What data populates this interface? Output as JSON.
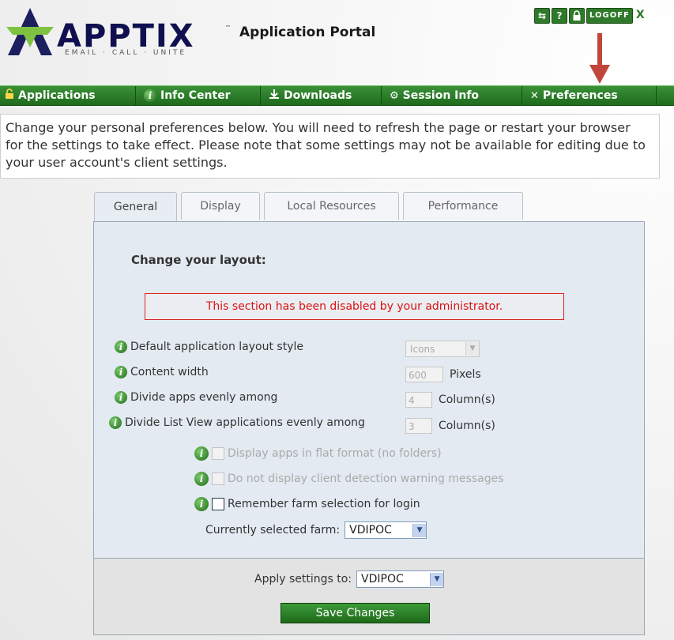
{
  "header": {
    "logo_word": "APPTIX",
    "logo_tm": "™",
    "logo_tagline": "EMAIL · CALL · UNITE",
    "title": "Application Portal",
    "top_icons": [
      "⇆",
      "?",
      "🔒"
    ],
    "logoff_label": "LOGOFF",
    "close_label": "X"
  },
  "nav": {
    "items": [
      {
        "label": "Applications",
        "icon": "lock-icon",
        "glyph": "🔓"
      },
      {
        "label": "Info Center",
        "icon": "info-icon",
        "glyph": "ℹ"
      },
      {
        "label": "Downloads",
        "icon": "download-icon",
        "glyph": "⤓"
      },
      {
        "label": "Session Info",
        "icon": "gear-icon",
        "glyph": "⚙"
      },
      {
        "label": "Preferences",
        "icon": "tools-icon",
        "glyph": "✕"
      }
    ]
  },
  "intro": "Change your personal preferences below. You will need to refresh the page or restart your browser for the settings to take effect. Please note that some settings may not be available for editing due to your user account's client settings.",
  "tabs": [
    "General",
    "Display",
    "Local Resources",
    "Performance"
  ],
  "active_tab": "General",
  "section": {
    "heading": "Change your layout:",
    "disabled_msg": "This section has been disabled by your administrator."
  },
  "settings": {
    "layout_style": {
      "label": "Default application layout style",
      "value": "Icons"
    },
    "content_width": {
      "label": "Content width",
      "value": "600",
      "unit": "Pixels"
    },
    "divide_apps": {
      "label": "Divide apps evenly among",
      "value": "4",
      "unit": "Column(s)"
    },
    "divide_list": {
      "label": "Divide List View applications evenly among",
      "value": "3",
      "unit": "Column(s)"
    },
    "flat_format": {
      "label": "Display apps in flat format (no folders)",
      "checked": false,
      "enabled": false
    },
    "no_client_warn": {
      "label": "Do not display client detection warning messages",
      "checked": false,
      "enabled": false
    },
    "remember_farm": {
      "label": "Remember farm selection for login",
      "checked": false,
      "enabled": true
    },
    "current_farm": {
      "label": "Currently selected farm:",
      "value": "VDIPOC"
    }
  },
  "apply": {
    "label": "Apply settings to:",
    "value": "VDIPOC"
  },
  "save_label": "Save Changes",
  "colors": {
    "nav_green": "#2a7d27",
    "disabled_red": "#dd1111",
    "arrow_red": "#c0453a",
    "panel_bg": "#e3eaf1"
  }
}
